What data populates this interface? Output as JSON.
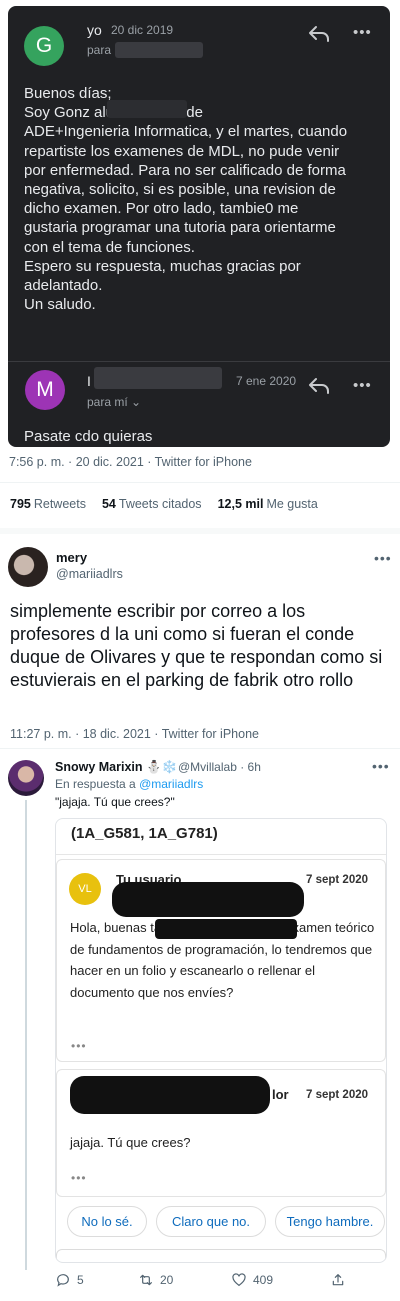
{
  "email1": {
    "avatar_letter": "G",
    "sender": "yo",
    "date": "20 dic 2019",
    "to_label": "para",
    "body": "Buenos días;\nSoy Gonz                          alumno de 1º de\nADE+Ingenieria Informatica, y el martes, cuando\nrepartiste los examenes de MDL, no pude venir\npor enfermedad. Para no ser calificado de forma\nnegativa, solicito, si es posible, una revision de\ndicho examen. Por otro lado, tambie0 me\ngustaria programar una tutoria para orientarme\ncon el tema de funciones.\nEspero su respuesta, muchas gracias por\nadelantado.\nUn saludo."
  },
  "email2": {
    "avatar_letter": "M",
    "sender": "I",
    "date": "7 ene 2020",
    "to_label": "para mí ⌄",
    "body": "Pasate cdo quieras"
  },
  "main_tweet": {
    "timestamp": "7:56 p. m. · 20 dic. 2021 · Twitter for iPhone",
    "stats": [
      {
        "value": "795",
        "label": "Retweets"
      },
      {
        "value": "54",
        "label": "Tweets citados"
      },
      {
        "value": "12,5 mil",
        "label": "Me gusta"
      }
    ]
  },
  "mery_tweet": {
    "name": "mery",
    "handle": "@mariiadlrs",
    "more": "•••",
    "text": "simplemente escribir por correo a los profesores d la uni como si fueran el conde duque de Olivares y que te respondan como si estuvierais en el parking de fabrik otro rollo",
    "timestamp": "11:27 p. m. · 18 dic. 2021 · Twitter for iPhone"
  },
  "snowy_tweet": {
    "name": "Snowy Marixin ⛄❄️",
    "handle": "@Mvillalab · 6h",
    "reply_prefix": "En respuesta a",
    "reply_to": "@mariiadlrs",
    "quote": "\"jajaja. Tú que crees?\"",
    "more": "•••"
  },
  "teams_card": {
    "course": "(1A_G581, 1A_G781)",
    "msg1": {
      "avatar": "VL",
      "sender": "Tu usuario",
      "date": "7 sept 2020",
      "body": "Hola, buenas tardes, soy Ma                      GII, ¿el examen teórico de fundamentos de programación, lo tendremos que hacer en un folio y escanearlo o rellenar el documento que nos envíes?",
      "dots": "•••"
    },
    "msg2": {
      "sender_tail": "lor",
      "date": "7 sept 2020",
      "body": "jajaja. Tú que crees?",
      "dots": "•••"
    },
    "chips": [
      "No lo sé.",
      "Claro que no.",
      "Tengo hambre."
    ]
  },
  "actions": {
    "replies": "5",
    "retweets": "20",
    "likes": "409"
  },
  "colors": {
    "dark_card_bg": "#202124",
    "link_blue": "#1d9bf0",
    "chip_blue": "#0f6cbd",
    "avatar_green": "#35a35e",
    "avatar_purple": "#9d34b5",
    "avatar_yellow": "#e8c10e"
  }
}
